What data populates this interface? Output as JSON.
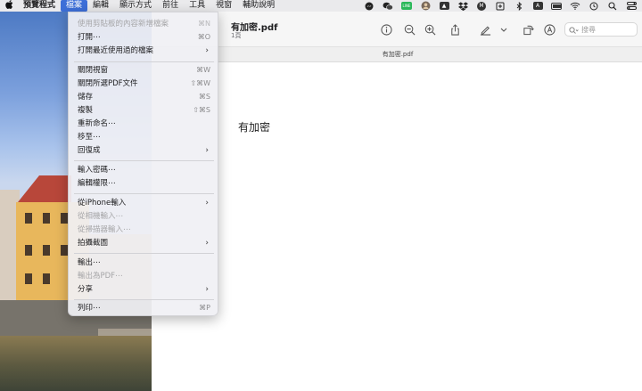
{
  "menubar": {
    "apple_icon": "",
    "items": [
      "預覽程式",
      "檔案",
      "編輯",
      "顯示方式",
      "前往",
      "工具",
      "視窗",
      "輔助說明"
    ],
    "active_index": 1,
    "status_icons": [
      "messenger-icon",
      "wechat-icon",
      "line-icon",
      "avatar-icon",
      "arrow-box-icon",
      "dropbox-icon",
      "m-icon",
      "box-icon",
      "bluetooth-icon",
      "input-method-icon",
      "battery-icon",
      "wifi-icon",
      "time-machine-icon",
      "search-icon",
      "control-center-icon"
    ],
    "line_label": "LINE",
    "input_method": "A",
    "m_label": "M"
  },
  "document": {
    "title": "有加密.pdf",
    "pages": "1頁",
    "tab_title": "有加密.pdf",
    "body_text": "有加密"
  },
  "toolbar": {
    "search_placeholder": "搜尋",
    "icons": [
      "info-icon",
      "zoom-out-icon",
      "zoom-in-icon",
      "share-icon",
      "markup-pen-icon",
      "chevron-down-icon",
      "rotate-icon",
      "annotate-icon"
    ]
  },
  "file_menu": {
    "items": [
      {
        "label": "使用剪貼板的內容新增檔案",
        "shortcut": "⌘N",
        "disabled": true
      },
      {
        "label": "打開⋯",
        "shortcut": "⌘O",
        "disabled": false
      },
      {
        "label": "打開最近使用過的檔案",
        "submenu": true,
        "disabled": false
      },
      {
        "label": "關閉視窗",
        "shortcut": "⌘W",
        "disabled": false
      },
      {
        "label": "關閉所選PDF文件",
        "shortcut": "⇧⌘W",
        "disabled": false
      },
      {
        "label": "儲存",
        "shortcut": "⌘S",
        "disabled": false
      },
      {
        "label": "複製",
        "shortcut": "⇧⌘S",
        "disabled": false
      },
      {
        "label": "重新命名⋯",
        "disabled": false
      },
      {
        "label": "移至⋯",
        "disabled": false
      },
      {
        "label": "回復成",
        "submenu": true,
        "disabled": false
      },
      {
        "label": "輸入密碼⋯",
        "disabled": false
      },
      {
        "label": "編輯權限⋯",
        "disabled": false
      },
      {
        "label": "從iPhone輸入",
        "submenu": true,
        "disabled": false
      },
      {
        "label": "從相機輸入⋯",
        "disabled": true
      },
      {
        "label": "從掃描器輸入⋯",
        "disabled": true
      },
      {
        "label": "拍攝截圖",
        "submenu": true,
        "disabled": false
      },
      {
        "label": "輸出⋯",
        "disabled": false
      },
      {
        "label": "輸出為PDF⋯",
        "disabled": true
      },
      {
        "label": "分享",
        "submenu": true,
        "disabled": false
      },
      {
        "label": "列印⋯",
        "shortcut": "⌘P",
        "disabled": false
      }
    ]
  }
}
